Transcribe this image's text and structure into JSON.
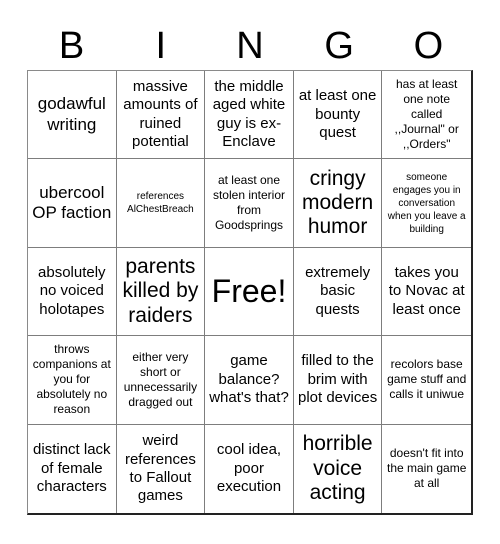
{
  "card": {
    "header_letters": [
      "B",
      "I",
      "N",
      "G",
      "O"
    ],
    "cells": [
      {
        "text": "godawful writing",
        "size": "lg"
      },
      {
        "text": "massive amounts of ruined potential",
        "size": "md"
      },
      {
        "text": "the middle aged white guy is ex-Enclave",
        "size": "md"
      },
      {
        "text": "at least one bounty quest",
        "size": "md"
      },
      {
        "text": "has at least one note called ,,Journal\" or ,,Orders\"",
        "size": "sm"
      },
      {
        "text": "ubercool OP faction",
        "size": "lg"
      },
      {
        "text": "references AlChestBreach",
        "size": "xs"
      },
      {
        "text": "at least one stolen interior from Goodsprings",
        "size": "sm"
      },
      {
        "text": "cringy modern humor",
        "size": "xl"
      },
      {
        "text": "someone engages you in conversation when you leave a building",
        "size": "xs"
      },
      {
        "text": "absolutely no voiced holotapes",
        "size": "md"
      },
      {
        "text": "parents killed by raiders",
        "size": "xl"
      },
      {
        "text": "Free!",
        "size": "xxl"
      },
      {
        "text": "extremely basic quests",
        "size": "md"
      },
      {
        "text": "takes you to Novac at least once",
        "size": "md"
      },
      {
        "text": "throws companions at you for absolutely no reason",
        "size": "sm"
      },
      {
        "text": "either very short or unnecessarily dragged out",
        "size": "sm"
      },
      {
        "text": "game balance? what's that?",
        "size": "md"
      },
      {
        "text": "filled to the brim with plot devices",
        "size": "md"
      },
      {
        "text": "recolors base game stuff and calls it uniwue",
        "size": "sm"
      },
      {
        "text": "distinct lack of female characters",
        "size": "md"
      },
      {
        "text": "weird references to Fallout games",
        "size": "md"
      },
      {
        "text": "cool idea, poor execution",
        "size": "md"
      },
      {
        "text": "horrible voice acting",
        "size": "xl"
      },
      {
        "text": "doesn't fit into the main game at all",
        "size": "sm"
      }
    ]
  }
}
